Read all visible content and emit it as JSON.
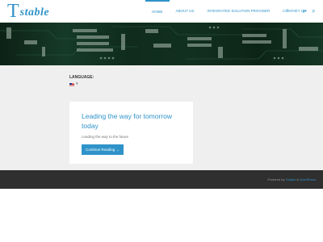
{
  "brand": {
    "logo_big": "T",
    "logo_rest": "stable"
  },
  "nav": {
    "items": [
      {
        "label": "HOME",
        "active": true
      },
      {
        "label": "ABOUT US",
        "active": false
      },
      {
        "label": "INTEGRATED SOLUTION PROVIDER",
        "active": false
      },
      {
        "label": "CONTACT US",
        "active": false
      }
    ],
    "social": [
      "f",
      "t",
      "g+",
      "p"
    ]
  },
  "language": {
    "label": "LANGUAGE:",
    "selected_arrow": "▾"
  },
  "post": {
    "title": "Leading the way for tomorrow today",
    "excerpt": "Leading the way to the future",
    "button": "Continue Reading →"
  },
  "footer": {
    "prefix": "Powered by ",
    "link1": "Tstable",
    "sep": " & ",
    "link2": "WordPress."
  },
  "colors": {
    "accent": "#2f93c9",
    "main_bg": "#efefef",
    "footer_bg": "#2f2f2f"
  }
}
